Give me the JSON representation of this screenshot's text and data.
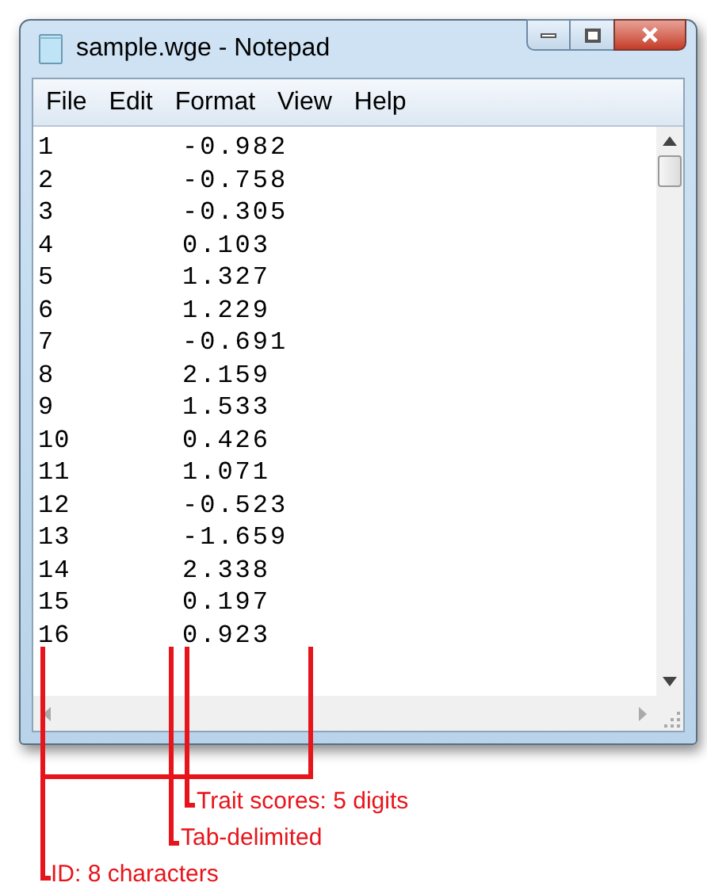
{
  "window": {
    "title": "sample.wge - Notepad"
  },
  "menu": [
    "File",
    "Edit",
    "Format",
    "View",
    "Help"
  ],
  "lines": [
    {
      "id": "1",
      "value": "-0.982"
    },
    {
      "id": "2",
      "value": "-0.758"
    },
    {
      "id": "3",
      "value": "-0.305"
    },
    {
      "id": "4",
      "value": "0.103"
    },
    {
      "id": "5",
      "value": "1.327"
    },
    {
      "id": "6",
      "value": "1.229"
    },
    {
      "id": "7",
      "value": "-0.691"
    },
    {
      "id": "8",
      "value": "2.159"
    },
    {
      "id": "9",
      "value": "1.533"
    },
    {
      "id": "10",
      "value": "0.426"
    },
    {
      "id": "11",
      "value": "1.071"
    },
    {
      "id": "12",
      "value": "-0.523"
    },
    {
      "id": "13",
      "value": "-1.659"
    },
    {
      "id": "14",
      "value": "2.338"
    },
    {
      "id": "15",
      "value": "0.197"
    },
    {
      "id": "16",
      "value": "0.923"
    }
  ],
  "annotations": [
    "Trait scores: 5 digits",
    "Tab-delimited",
    "ID: 8 characters"
  ]
}
